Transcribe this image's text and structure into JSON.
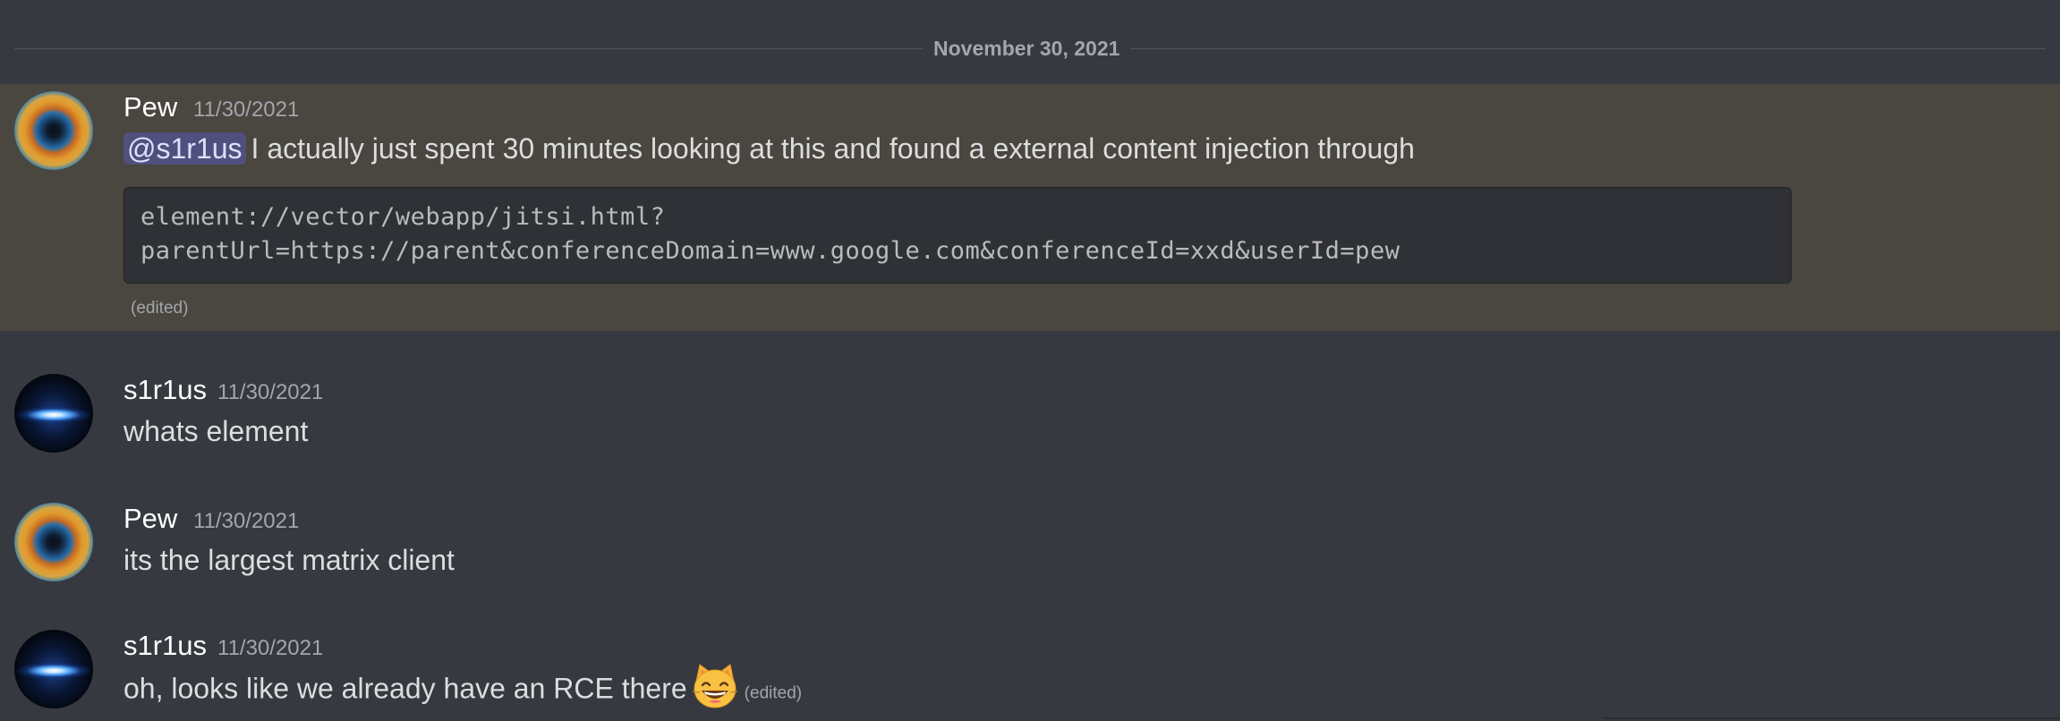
{
  "date_divider": "November 30, 2021",
  "messages": [
    {
      "author": "Pew",
      "timestamp": "11/30/2021",
      "mention": "@s1r1us",
      "text": "I actually just spent 30 minutes looking at this and found a external content injection through",
      "code_lines": [
        "element://vector/webapp/jitsi.html?",
        "parentUrl=https://parent&conferenceDomain=www.google.com&conferenceId=xxd&userId=pew"
      ],
      "edited": "(edited)"
    },
    {
      "author": "s1r1us",
      "timestamp": "11/30/2021",
      "text": "whats element"
    },
    {
      "author": "Pew",
      "timestamp": "11/30/2021",
      "text": "its the largest matrix client"
    },
    {
      "author": "s1r1us",
      "timestamp": "11/30/2021",
      "text": "oh, looks like we already have an RCE there",
      "emoji": "smiling-cat-emoji",
      "edited": "(edited)"
    }
  ],
  "colors": {
    "background": "#36393f",
    "highlight": "#4a4640",
    "mention_bg": "#5865f2",
    "codeblock_bg": "#2f3136"
  }
}
